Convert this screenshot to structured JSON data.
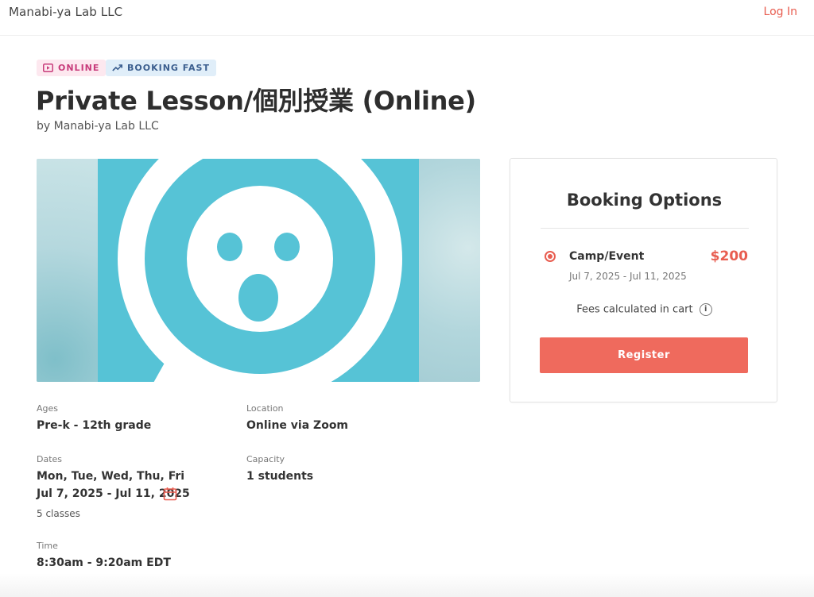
{
  "header": {
    "brand": "Manabi-ya Lab LLC",
    "login_label": "Log In"
  },
  "badges": {
    "online": "ONLINE",
    "booking": "BOOKING FAST"
  },
  "listing": {
    "title": "Private Lesson/個別授業 (Online)",
    "byline": "by Manabi-ya Lab LLC"
  },
  "details": {
    "ages_label": "Ages",
    "ages_value": "Pre-k - 12th grade",
    "location_label": "Location",
    "location_value": "Online via Zoom",
    "dates_label": "Dates",
    "dates_days": "Mon, Tue, Wed, Thu, Fri",
    "dates_range": "Jul 7, 2025 - Jul 11, 2025",
    "dates_classes": "5 classes",
    "capacity_label": "Capacity",
    "capacity_value": "1 students",
    "time_label": "Time",
    "time_value": "8:30am - 9:20am EDT"
  },
  "booking": {
    "title": "Booking Options",
    "option_name": "Camp/Event",
    "option_price": "$200",
    "option_dates": "Jul 7, 2025 - Jul 11, 2025",
    "fees_note": "Fees calculated in cart",
    "register_label": "Register"
  },
  "colors": {
    "accent": "#ef6a5d",
    "hero_teal": "#56c3d6",
    "online_badge_bg": "#fde8ef",
    "booking_badge_bg": "#e0eef9"
  }
}
